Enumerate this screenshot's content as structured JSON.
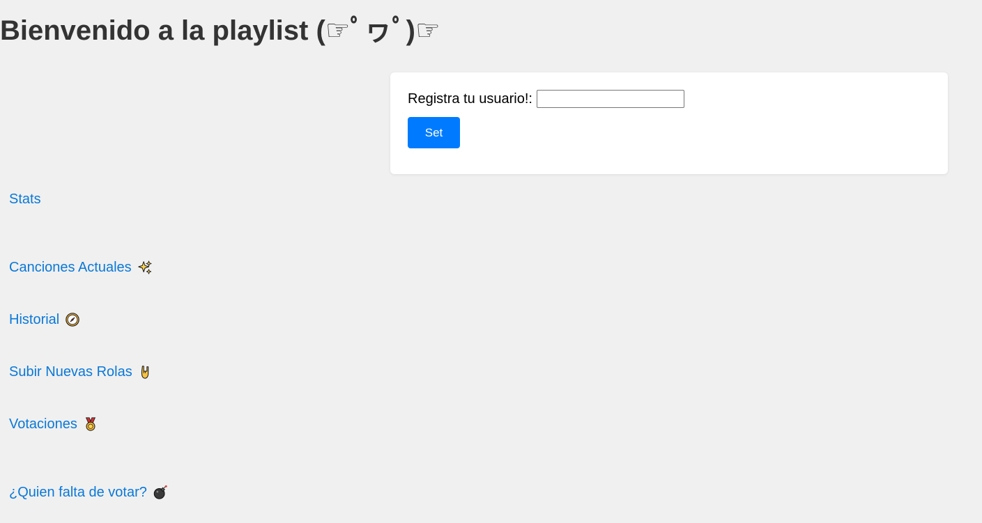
{
  "page": {
    "title": "Bienvenido a la playlist (☞ﾟヮﾟ)☞"
  },
  "register": {
    "label": "Registra tu usuario!:",
    "input_value": "",
    "button_label": "Set"
  },
  "nav": {
    "items": [
      {
        "label": "Stats",
        "icon": ""
      },
      {
        "label": "Canciones Actuales",
        "icon": "sparkles-icon"
      },
      {
        "label": "Historial",
        "icon": "compass-icon"
      },
      {
        "label": "Subir Nuevas Rolas",
        "icon": "rock-hand-icon"
      },
      {
        "label": "Votaciones",
        "icon": "medal-icon"
      },
      {
        "label": "¿Quien falta de votar?",
        "icon": "bomb-icon"
      }
    ]
  },
  "colors": {
    "background": "#f0f0f0",
    "title": "#333333",
    "link": "#0a78d8",
    "button": "#007bff",
    "card": "#ffffff"
  }
}
